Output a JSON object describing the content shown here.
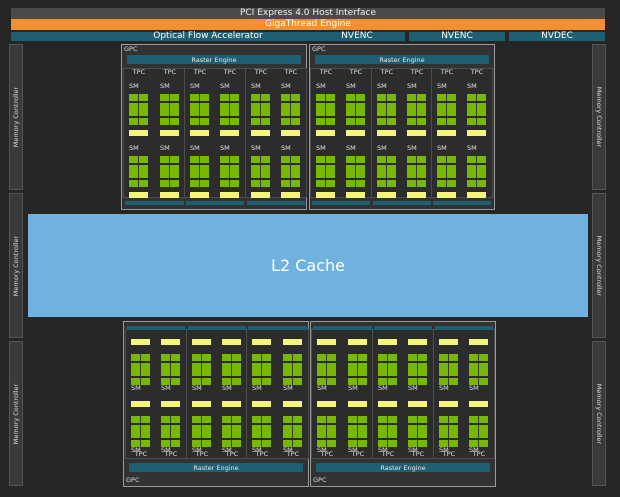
{
  "header": {
    "pcie": "PCI Express 4.0 Host Interface",
    "gigathread": "GigaThread Engine",
    "optical_flow": "Optical Flow Accelerator",
    "nvenc_1": "NVENC",
    "nvenc_2": "NVENC",
    "nvdec": "NVDEC"
  },
  "memory_controller_label": "Memory Controller",
  "l2_cache": "L2 Cache",
  "gpc": {
    "label": "GPC",
    "raster": "Raster Engine",
    "tpc": "TPC",
    "sm": "SM"
  },
  "colors": {
    "background": "#262626",
    "gigathread": "#f28f30",
    "teal": "#1f5f73",
    "l2": "#6fb2e0",
    "cuda_core": "#77b900",
    "rt_core": "#f5f57a"
  }
}
